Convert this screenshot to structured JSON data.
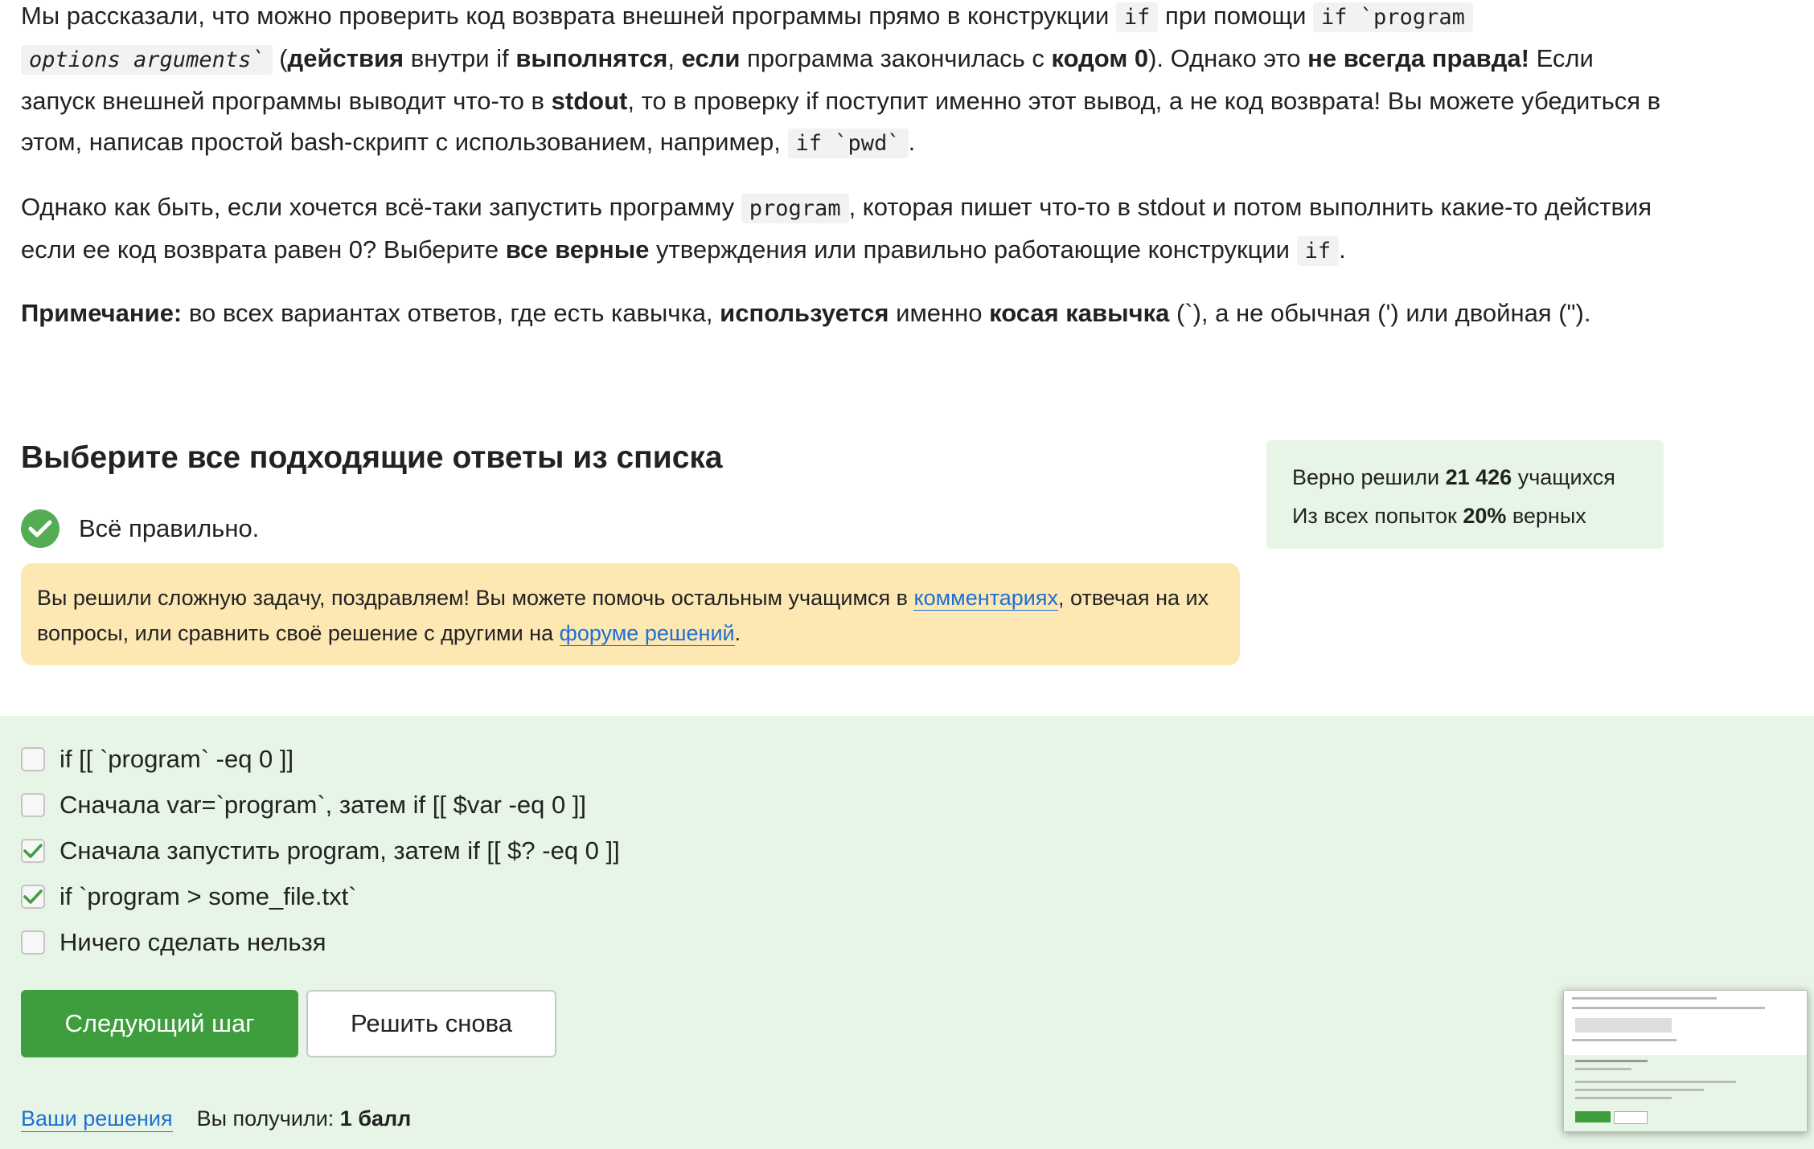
{
  "intro": {
    "p1": {
      "t1": "Мы рассказали, что можно проверить код возврата внешней программы прямо в конструкции ",
      "c1": "if",
      "t2": " при помощи ",
      "c2": "if `program",
      "c3": "options arguments`",
      "t3": " (",
      "b1": "действия",
      "t4": " внутри if ",
      "b2": "выполнятся",
      "t5": ", ",
      "b3": "если",
      "t6": " программа закончилась с ",
      "b4": "кодом 0",
      "t7": "). Однако это ",
      "b5": "не всегда правда!",
      "t8": " Если запуск внешней программы выводит что-то в ",
      "b6": "stdout",
      "t9": ", то в проверку if поступит именно этот вывод, а не код возврата! Вы можете убедиться в этом, написав простой bash-скрипт с использованием, например, ",
      "c4": "if `pwd`",
      "t10": "."
    },
    "p2": {
      "t1": "Однако как быть, если хочется всё-таки запустить программу ",
      "c1": "program",
      "t2": ", которая пишет что-то в stdout и потом выполнить какие-то действия если ее код возврата равен 0? Выберите ",
      "b1": "все верные",
      "t3": " утверждения или правильно работающие конструкции ",
      "c2": "if",
      "t4": "."
    },
    "p3": {
      "b1": "Примечание:",
      "t1": " во всех вариантах ответов, где есть кавычка, ",
      "b2": "используется",
      "t2": " именно ",
      "b3": "косая кавычка",
      "t3": " (`), а не обычная (') или двойная (\")."
    }
  },
  "quiz": {
    "title": "Выберите все подходящие ответы из списка",
    "status": "Всё правильно.",
    "hint": {
      "t1": "Вы решили сложную задачу, поздравляем! Вы можете помочь остальным учащимся в ",
      "link1": "комментариях",
      "t2": ", отвечая на их вопросы, или сравнить своё решение с другими на ",
      "link2": "форуме решений",
      "t3": "."
    },
    "stats": {
      "line1_prefix": "Верно решили ",
      "solved_count": "21 426",
      "line1_suffix": " учащихся",
      "line2_prefix": "Из всех попыток ",
      "percent": "20%",
      "line2_suffix": " верных"
    },
    "options": [
      {
        "label": "if [[ `program` -eq 0 ]]",
        "checked": false
      },
      {
        "label": "Сначала var=`program`, затем if [[ $var -eq 0 ]]",
        "checked": false
      },
      {
        "label": "Сначала запустить program, затем if [[ $? -eq 0 ]]",
        "checked": true
      },
      {
        "label": "if `program > some_file.txt`",
        "checked": true
      },
      {
        "label": "Ничего сделать нельзя",
        "checked": false
      }
    ],
    "next_button": "Следующий шаг",
    "retry_button": "Решить снова",
    "footer": {
      "solutions_link": "Ваши решения",
      "score_prefix": "Вы получили: ",
      "score_value": "1 балл"
    }
  },
  "colors": {
    "accent_green": "#3e9e3e",
    "answer_bg": "#e6f5e6",
    "hint_bg": "#fde8b4",
    "link": "#1e6fd6"
  },
  "icons": [
    "check-circle-icon",
    "checkmark-icon",
    "checkbox-icon"
  ]
}
